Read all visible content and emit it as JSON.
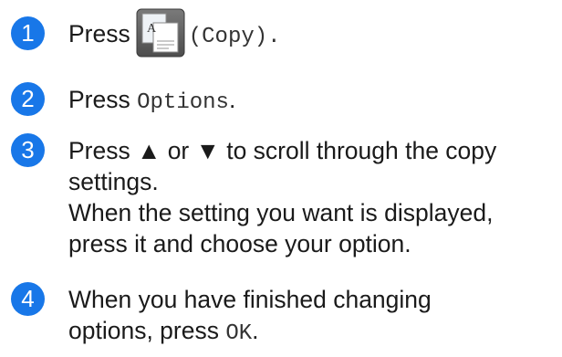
{
  "steps": [
    {
      "number": "1",
      "text_before": "Press",
      "icon": "copy-key-icon",
      "icon_letter": "A",
      "text_after_mono": "(Copy).",
      "text_after": ""
    },
    {
      "number": "2",
      "text_before": "Press ",
      "mono": "Options",
      "text_after": "."
    },
    {
      "number": "3",
      "line1": "Press ▲ or ▼ to scroll through the copy",
      "line2": "settings.",
      "line3": "When the setting you want is displayed,",
      "line4": "press it and choose your option."
    },
    {
      "number": "4",
      "line1": "When you have finished changing",
      "line2_before": "options, press ",
      "line2_mono": "OK",
      "line2_after": "."
    }
  ],
  "colors": {
    "step_circle": "#1877e8",
    "key_dark": "#5a5a5a",
    "key_light": "#dcdcdc"
  }
}
